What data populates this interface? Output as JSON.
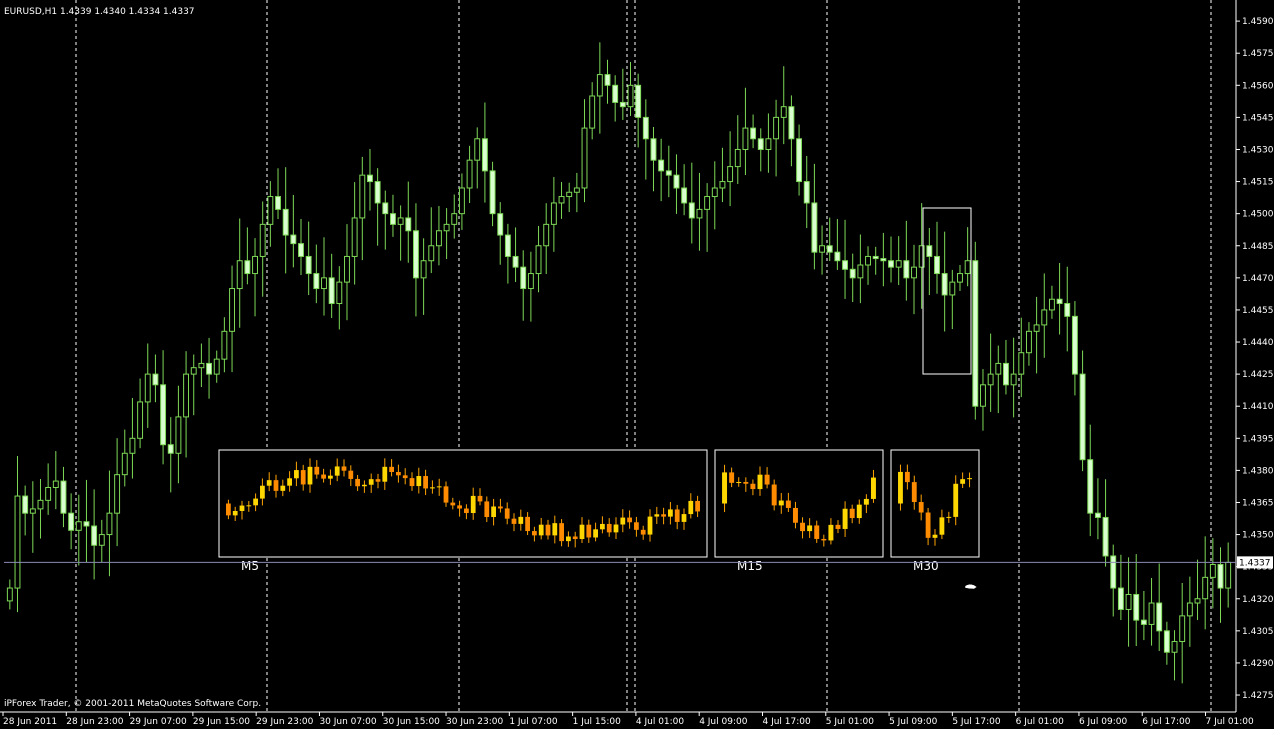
{
  "chart_header": "EURUSD,H1  1.4339 1.4340 1.4334 1.4337",
  "footer": "iPForex Trader, © 2001-2011 MetaQuotes Software Corp.",
  "colors": {
    "background": "#000000",
    "candle_main": "#7ED957",
    "candle_main_body_bull": "#000000",
    "candle_main_body_bear": "#D9FFD0",
    "candle_inset": "#FFA500",
    "inset_bull_body": "#FFD700",
    "inset_bear_body": "#FF8C00",
    "grid": "#FFFFFF",
    "price_line": "#8C8CB4",
    "text": "#FFFFFF"
  },
  "chart_data": {
    "type": "candlestick",
    "symbol": "EURUSD",
    "timeframe": "H1",
    "ohlc_header": {
      "open": 1.4339,
      "high": 1.434,
      "low": 1.4334,
      "close": 1.4337
    },
    "current_price": 1.4337,
    "y_ticks": [
      "1.4590",
      "1.4575",
      "1.4560",
      "1.4545",
      "1.4530",
      "1.4515",
      "1.4500",
      "1.4485",
      "1.4470",
      "1.4455",
      "1.4440",
      "1.4425",
      "1.4410",
      "1.4395",
      "1.4380",
      "1.4365",
      "1.4350",
      "1.4335",
      "1.4320",
      "1.4305",
      "1.4290",
      "1.4275"
    ],
    "ylim": [
      1.4268,
      1.4598
    ],
    "x_ticks": [
      "28 Jun 2011",
      "28 Jun 23:00",
      "29 Jun 07:00",
      "29 Jun 15:00",
      "29 Jun 23:00",
      "30 Jun 07:00",
      "30 Jun 15:00",
      "30 Jun 23:00",
      "1 Jul 07:00",
      "1 Jul 15:00",
      "4 Jul 01:00",
      "4 Jul 09:00",
      "4 Jul 17:00",
      "5 Jul 01:00",
      "5 Jul 09:00",
      "5 Jul 17:00",
      "6 Jul 01:00",
      "6 Jul 09:00",
      "6 Jul 17:00",
      "7 Jul 01:00"
    ],
    "grid": "vertical dashed at day separators",
    "closes": [
      1.4325,
      1.4368,
      1.436,
      1.4362,
      1.4366,
      1.4372,
      1.4375,
      1.436,
      1.4352,
      1.4356,
      1.4354,
      1.4345,
      1.435,
      1.436,
      1.4378,
      1.4388,
      1.4395,
      1.4412,
      1.4425,
      1.442,
      1.4392,
      1.4388,
      1.4405,
      1.4425,
      1.4428,
      1.443,
      1.4425,
      1.4432,
      1.4445,
      1.4465,
      1.4478,
      1.4472,
      1.448,
      1.4495,
      1.4508,
      1.4502,
      1.449,
      1.4486,
      1.448,
      1.4472,
      1.4465,
      1.447,
      1.4458,
      1.4468,
      1.448,
      1.4498,
      1.4518,
      1.4515,
      1.4505,
      1.45,
      1.4495,
      1.4498,
      1.4492,
      1.447,
      1.4478,
      1.4485,
      1.4492,
      1.4495,
      1.45,
      1.4512,
      1.4525,
      1.4535,
      1.452,
      1.45,
      1.449,
      1.448,
      1.4475,
      1.4465,
      1.4472,
      1.4485,
      1.4495,
      1.4505,
      1.4508,
      1.451,
      1.4512,
      1.454,
      1.4555,
      1.4565,
      1.456,
      1.4552,
      1.455,
      1.456,
      1.4545,
      1.4535,
      1.4525,
      1.452,
      1.4518,
      1.4512,
      1.4505,
      1.4498,
      1.4502,
      1.4508,
      1.4512,
      1.4515,
      1.4522,
      1.453,
      1.454,
      1.4535,
      1.453,
      1.4535,
      1.4545,
      1.455,
      1.4535,
      1.4515,
      1.4505,
      1.4482,
      1.4485,
      1.4482,
      1.4478,
      1.4474,
      1.447,
      1.4476,
      1.448,
      1.4479,
      1.4478,
      1.4475,
      1.4478,
      1.447,
      1.4475,
      1.4485,
      1.448,
      1.4472,
      1.4462,
      1.4468,
      1.4472,
      1.4478,
      1.441,
      1.442,
      1.4425,
      1.443,
      1.442,
      1.4425,
      1.4435,
      1.4445,
      1.4448,
      1.4455,
      1.446,
      1.4458,
      1.4452,
      1.4425,
      1.4385,
      1.436,
      1.4358,
      1.434,
      1.4325,
      1.4315,
      1.4322,
      1.431,
      1.4308,
      1.4318,
      1.4305,
      1.4295,
      1.43,
      1.4312,
      1.4318,
      1.432,
      1.433,
      1.4336,
      1.4325,
      1.4337
    ],
    "insets": [
      {
        "label": "M5",
        "candles": 70
      },
      {
        "label": "M15",
        "candles": 22
      },
      {
        "label": "M30",
        "candles": 11
      }
    ]
  }
}
